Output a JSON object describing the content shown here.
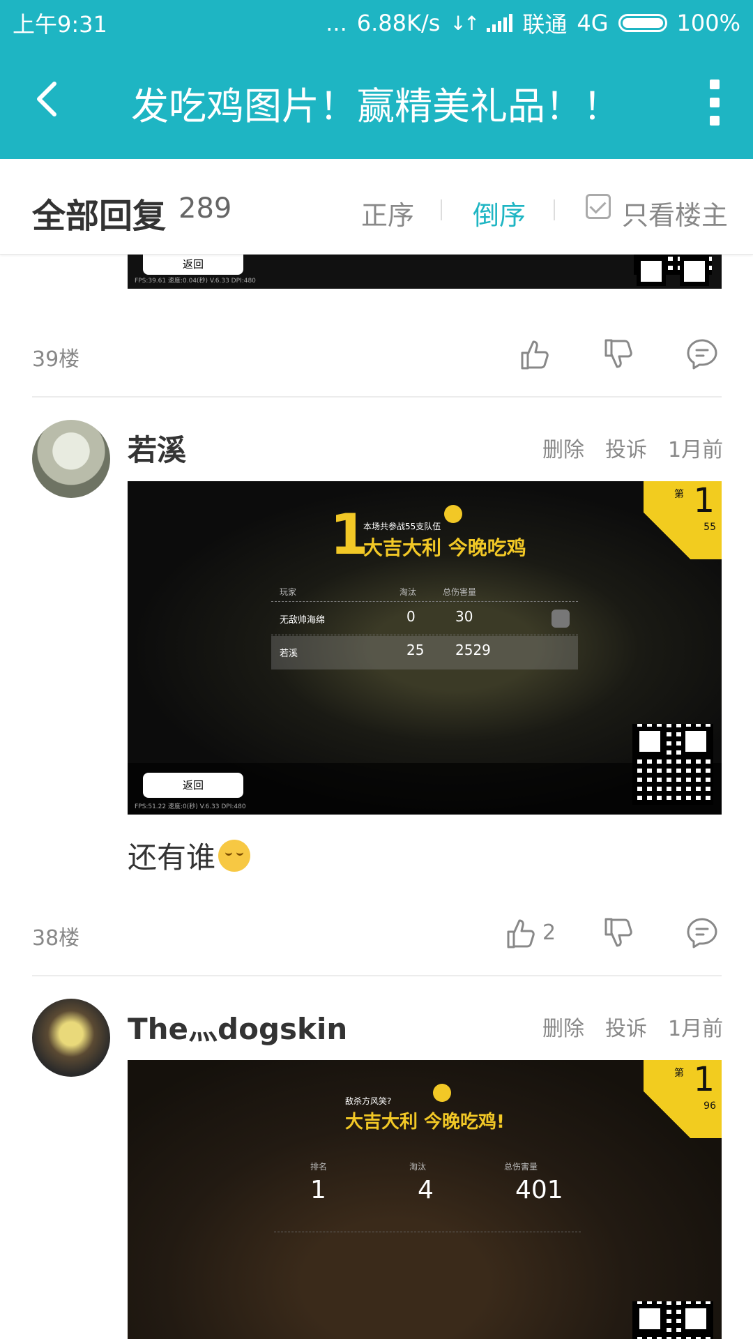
{
  "status": {
    "time": "上午9:31",
    "dots": "...",
    "speed": "6.88K/s",
    "carrier": "联通",
    "network": "4G",
    "battery": "100%"
  },
  "appbar": {
    "title": "发吃鸡图片！赢精美礼品！！",
    "back_icon": "back-arrow-icon",
    "more_icon": "more-vertical-icon"
  },
  "sortbar": {
    "all_label": "全部回复",
    "count": "289",
    "asc_label": "正序",
    "desc_label": "倒序",
    "owner_only_label": "只看楼主",
    "active": "倒序"
  },
  "posts": [
    {
      "floor": "39楼",
      "shot": {
        "back_label": "返回",
        "fps": "FPS:39.61 速度:0.04(秒) V.6.33 DPI:480"
      }
    },
    {
      "floor": "38楼",
      "user": "若溪",
      "delete": "删除",
      "report": "投诉",
      "time": "1月前",
      "text": "还有谁",
      "likes": "2",
      "shot": {
        "rank_prefix": "第",
        "rank": "1",
        "rank_total": "55",
        "big_rank": "1",
        "teams_info": "本场共参战55支队伍",
        "headline": "大吉大利 今晚吃鸡",
        "col_player": "玩家",
        "col_kills": "淘汰",
        "col_damage": "总伤害量",
        "rows": [
          {
            "name": "无敌帅海绵",
            "kills": "0",
            "damage": "30"
          },
          {
            "name": "若溪",
            "kills": "25",
            "damage": "2529"
          }
        ],
        "back_label": "返回",
        "fps": "FPS:51.22 速度:0(秒) V.6.33 DPI:480"
      }
    },
    {
      "user": "The灬dogskin",
      "delete": "删除",
      "report": "投诉",
      "time": "1月前",
      "shot": {
        "rank_prefix": "第",
        "rank": "1",
        "rank_total": "96",
        "subtitle": "敌杀方风笑?",
        "headline": "大吉大利 今晚吃鸡!",
        "col_rank": "排名",
        "col_kills": "淘汰",
        "col_damage": "总伤害量",
        "val_rank": "1",
        "val_kills": "4",
        "val_damage": "401"
      }
    }
  ],
  "colors": {
    "accent": "#1eb5c3",
    "badge": "#f2cc1f"
  }
}
